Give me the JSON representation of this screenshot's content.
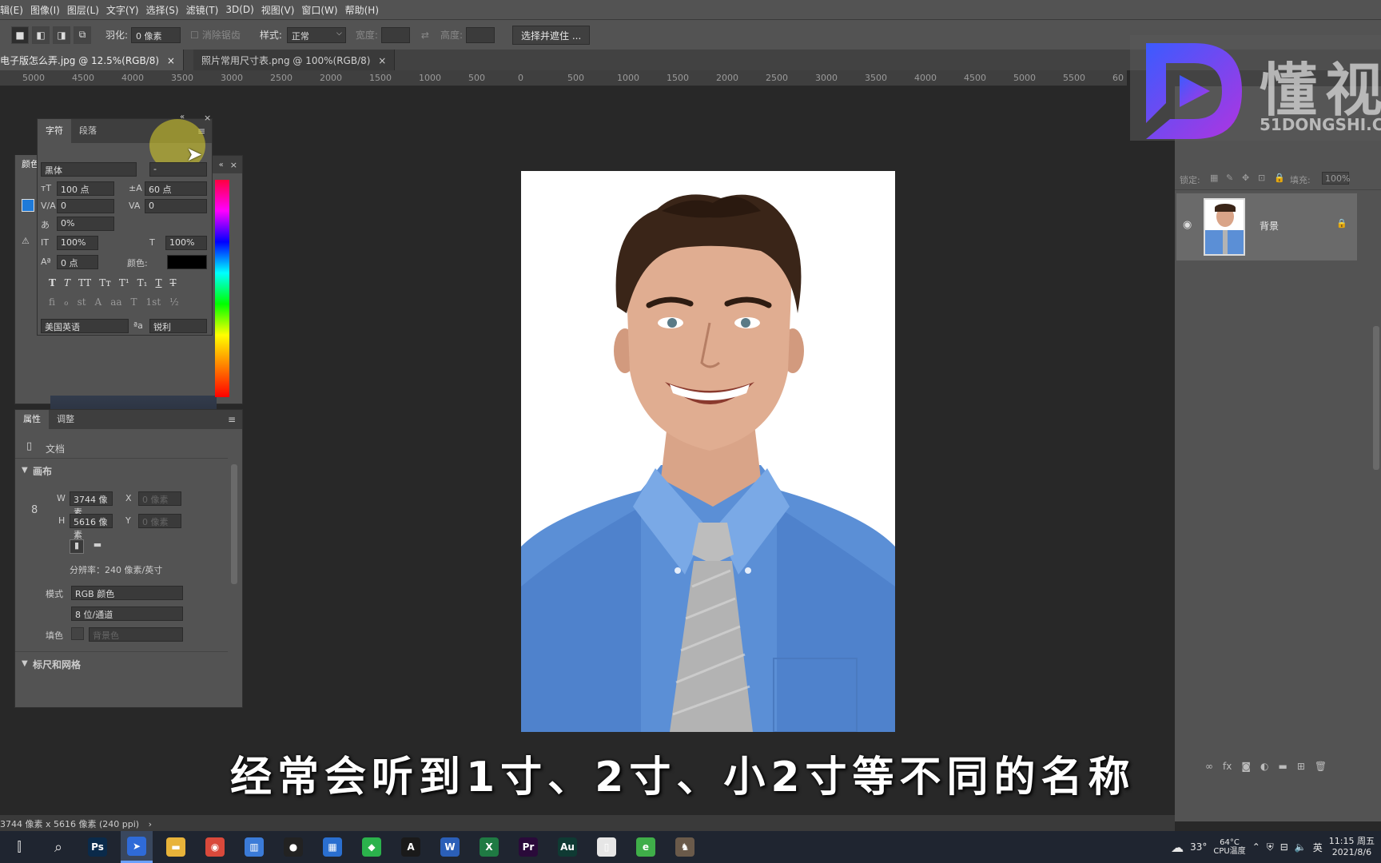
{
  "menu": [
    "辑(E)",
    "图像(I)",
    "图层(L)",
    "文字(Y)",
    "选择(S)",
    "滤镜(T)",
    "3D(D)",
    "视图(V)",
    "窗口(W)",
    "帮助(H)"
  ],
  "options": {
    "feather_label": "羽化:",
    "feather_value": "0 像素",
    "antialias_label": "消除锯齿",
    "style_label": "样式:",
    "style_value": "正常",
    "width_label": "宽度:",
    "height_label": "高度:",
    "select_mask_button": "选择并遮住 ..."
  },
  "tabs": [
    {
      "label": "电子版怎么弄.jpg @ 12.5%(RGB/8)",
      "close": "×"
    },
    {
      "label": "照片常用尺寸表.png @ 100%(RGB/8)",
      "close": "×"
    }
  ],
  "ruler_ticks": [
    "5000",
    "4500",
    "4000",
    "3500",
    "3000",
    "2500",
    "2000",
    "1500",
    "1000",
    "500",
    "0",
    "500",
    "1000",
    "1500",
    "2000",
    "2500",
    "3000",
    "3500",
    "4000",
    "4500",
    "5000",
    "5500",
    "60"
  ],
  "character_panel": {
    "tab_character": "字符",
    "tab_paragraph": "段落",
    "font_family": "黑体",
    "font_style": "-",
    "font_size": "100 点",
    "leading": "60 点",
    "kerning": "0",
    "tracking": "0",
    "tsume": "0%",
    "vscale": "100%",
    "hscale": "100%",
    "baseline": "0 点",
    "color_label": "颜色:",
    "style_glyphs": [
      "T",
      "T",
      "TT",
      "Tт",
      "T¹",
      "T₁",
      "T",
      "T"
    ],
    "opentype_glyphs": [
      "fi",
      "ℴ",
      "st",
      "A",
      "aa",
      "T",
      "1st",
      "½"
    ],
    "language": "美国英语",
    "antialias_icon": "ªa",
    "antialias": "锐利"
  },
  "color_panel": {
    "label": "颜色"
  },
  "properties_panel": {
    "tab_properties": "属性",
    "tab_adjust": "调整",
    "doc_label": "文档",
    "canvas_section": "画布",
    "w_label": "W",
    "w_value": "3744 像素",
    "x_label": "X",
    "x_placeholder": "0 像素",
    "h_label": "H",
    "h_value": "5616 像素",
    "y_label": "Y",
    "y_placeholder": "0 像素",
    "resolution": "分辨率：240 像素/英寸",
    "mode_label": "模式",
    "mode_value": "RGB 颜色",
    "depth_value": "8 位/通道",
    "fill_label": "填色",
    "fill_value": "背景色",
    "ruler_section": "标尺和网格"
  },
  "layers_panel": {
    "lock_label": "锁定:",
    "fill_label": "填充:",
    "fill_value": "100%",
    "layer_name": "背景"
  },
  "watermark": {
    "brand": "懂视",
    "url": "51DONGSHI.C"
  },
  "subtitle": "经常会听到1寸、2寸、小2寸等不同的名称",
  "status": "3744 像素 x 5616 像素 (240 ppi)",
  "taskbar": {
    "apps": [
      {
        "name": "ps-icon",
        "text": "Ps",
        "color": "#0a2a4a"
      },
      {
        "name": "cursor-app-icon",
        "text": "➤",
        "color": "#2f6bd8"
      },
      {
        "name": "folder-icon",
        "text": "▬",
        "color": "#e8b33a"
      },
      {
        "name": "chrome-icon",
        "text": "◉",
        "color": "#d9493b"
      },
      {
        "name": "store-icon",
        "text": "▥",
        "color": "#3b7bd8"
      },
      {
        "name": "record-icon",
        "text": "●",
        "color": "#222222"
      },
      {
        "name": "board-icon",
        "text": "▦",
        "color": "#2a6fd0"
      },
      {
        "name": "green-app-icon",
        "text": "◆",
        "color": "#2bb24c"
      },
      {
        "name": "acrobat-icon",
        "text": "A",
        "color": "#1a1a1a"
      },
      {
        "name": "word-icon",
        "text": "W",
        "color": "#2b5fb8"
      },
      {
        "name": "excel-icon",
        "text": "X",
        "color": "#1f7a43"
      },
      {
        "name": "premiere-icon",
        "text": "Pr",
        "color": "#2a0a3a"
      },
      {
        "name": "audition-icon",
        "text": "Au",
        "color": "#0f3a33"
      },
      {
        "name": "file-icon",
        "text": "▯",
        "color": "#e6e6e6"
      },
      {
        "name": "browser-icon",
        "text": "e",
        "color": "#3fae49"
      },
      {
        "name": "photo-app-icon",
        "text": "♞",
        "color": "#6a5a4a"
      }
    ],
    "weather": "33°",
    "cpu_temp": "64°C",
    "cpu_label": "CPU温度",
    "ime": "英",
    "time": "11:15 周五",
    "date": "2021/8/6"
  }
}
